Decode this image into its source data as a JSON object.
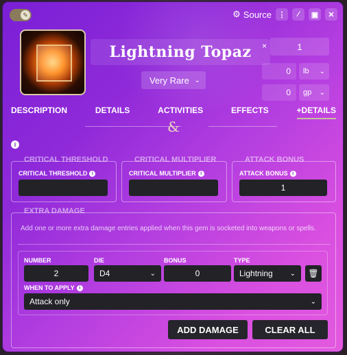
{
  "header": {
    "source_label": "Source",
    "icons": [
      "wrench-icon",
      "cog-icon",
      "dots-vertical-icon",
      "wand-icon",
      "file-icon",
      "close-icon"
    ]
  },
  "item": {
    "name": "Lightning Topaz",
    "rarity": "Very Rare",
    "quantity_prefix": "×",
    "quantity": "1",
    "weight": "0",
    "weight_unit": "lb",
    "price": "0",
    "price_unit": "gp"
  },
  "tabs": [
    {
      "label": "DESCRIPTION"
    },
    {
      "label": "DETAILS"
    },
    {
      "label": "ACTIVITIES"
    },
    {
      "label": "EFFECTS"
    },
    {
      "label": "+DETAILS",
      "active": true
    }
  ],
  "divider_glyph": "&",
  "sections": {
    "critical_threshold": {
      "legend": "CRITICAL THRESHOLD",
      "label": "CRITICAL THRESHOLD",
      "value": ""
    },
    "critical_multiplier": {
      "legend": "CRITICAL MULTIPLIER",
      "label": "CRITICAL MULTIPLIER",
      "value": ""
    },
    "attack_bonus": {
      "legend": "ATTACK BONUS",
      "label": "ATTACK BONUS",
      "value": "1"
    },
    "extra_damage": {
      "legend": "EXTRA DAMAGE",
      "note": "Add one or more extra damage entries applied when this gem is socketed into weapons or spells.",
      "entry": {
        "number_label": "NUMBER",
        "number": "2",
        "die_label": "DIE",
        "die": "D4",
        "bonus_label": "BONUS",
        "bonus": "0",
        "type_label": "TYPE",
        "type": "Lightning",
        "when_label": "WHEN TO APPLY",
        "when": "Attack only"
      },
      "add_button": "ADD DAMAGE",
      "clear_button": "CLEAR ALL"
    }
  },
  "colors": {
    "accent_from": "#7a1fd6",
    "accent_to": "#e35adf",
    "input_bg": "#222227"
  }
}
